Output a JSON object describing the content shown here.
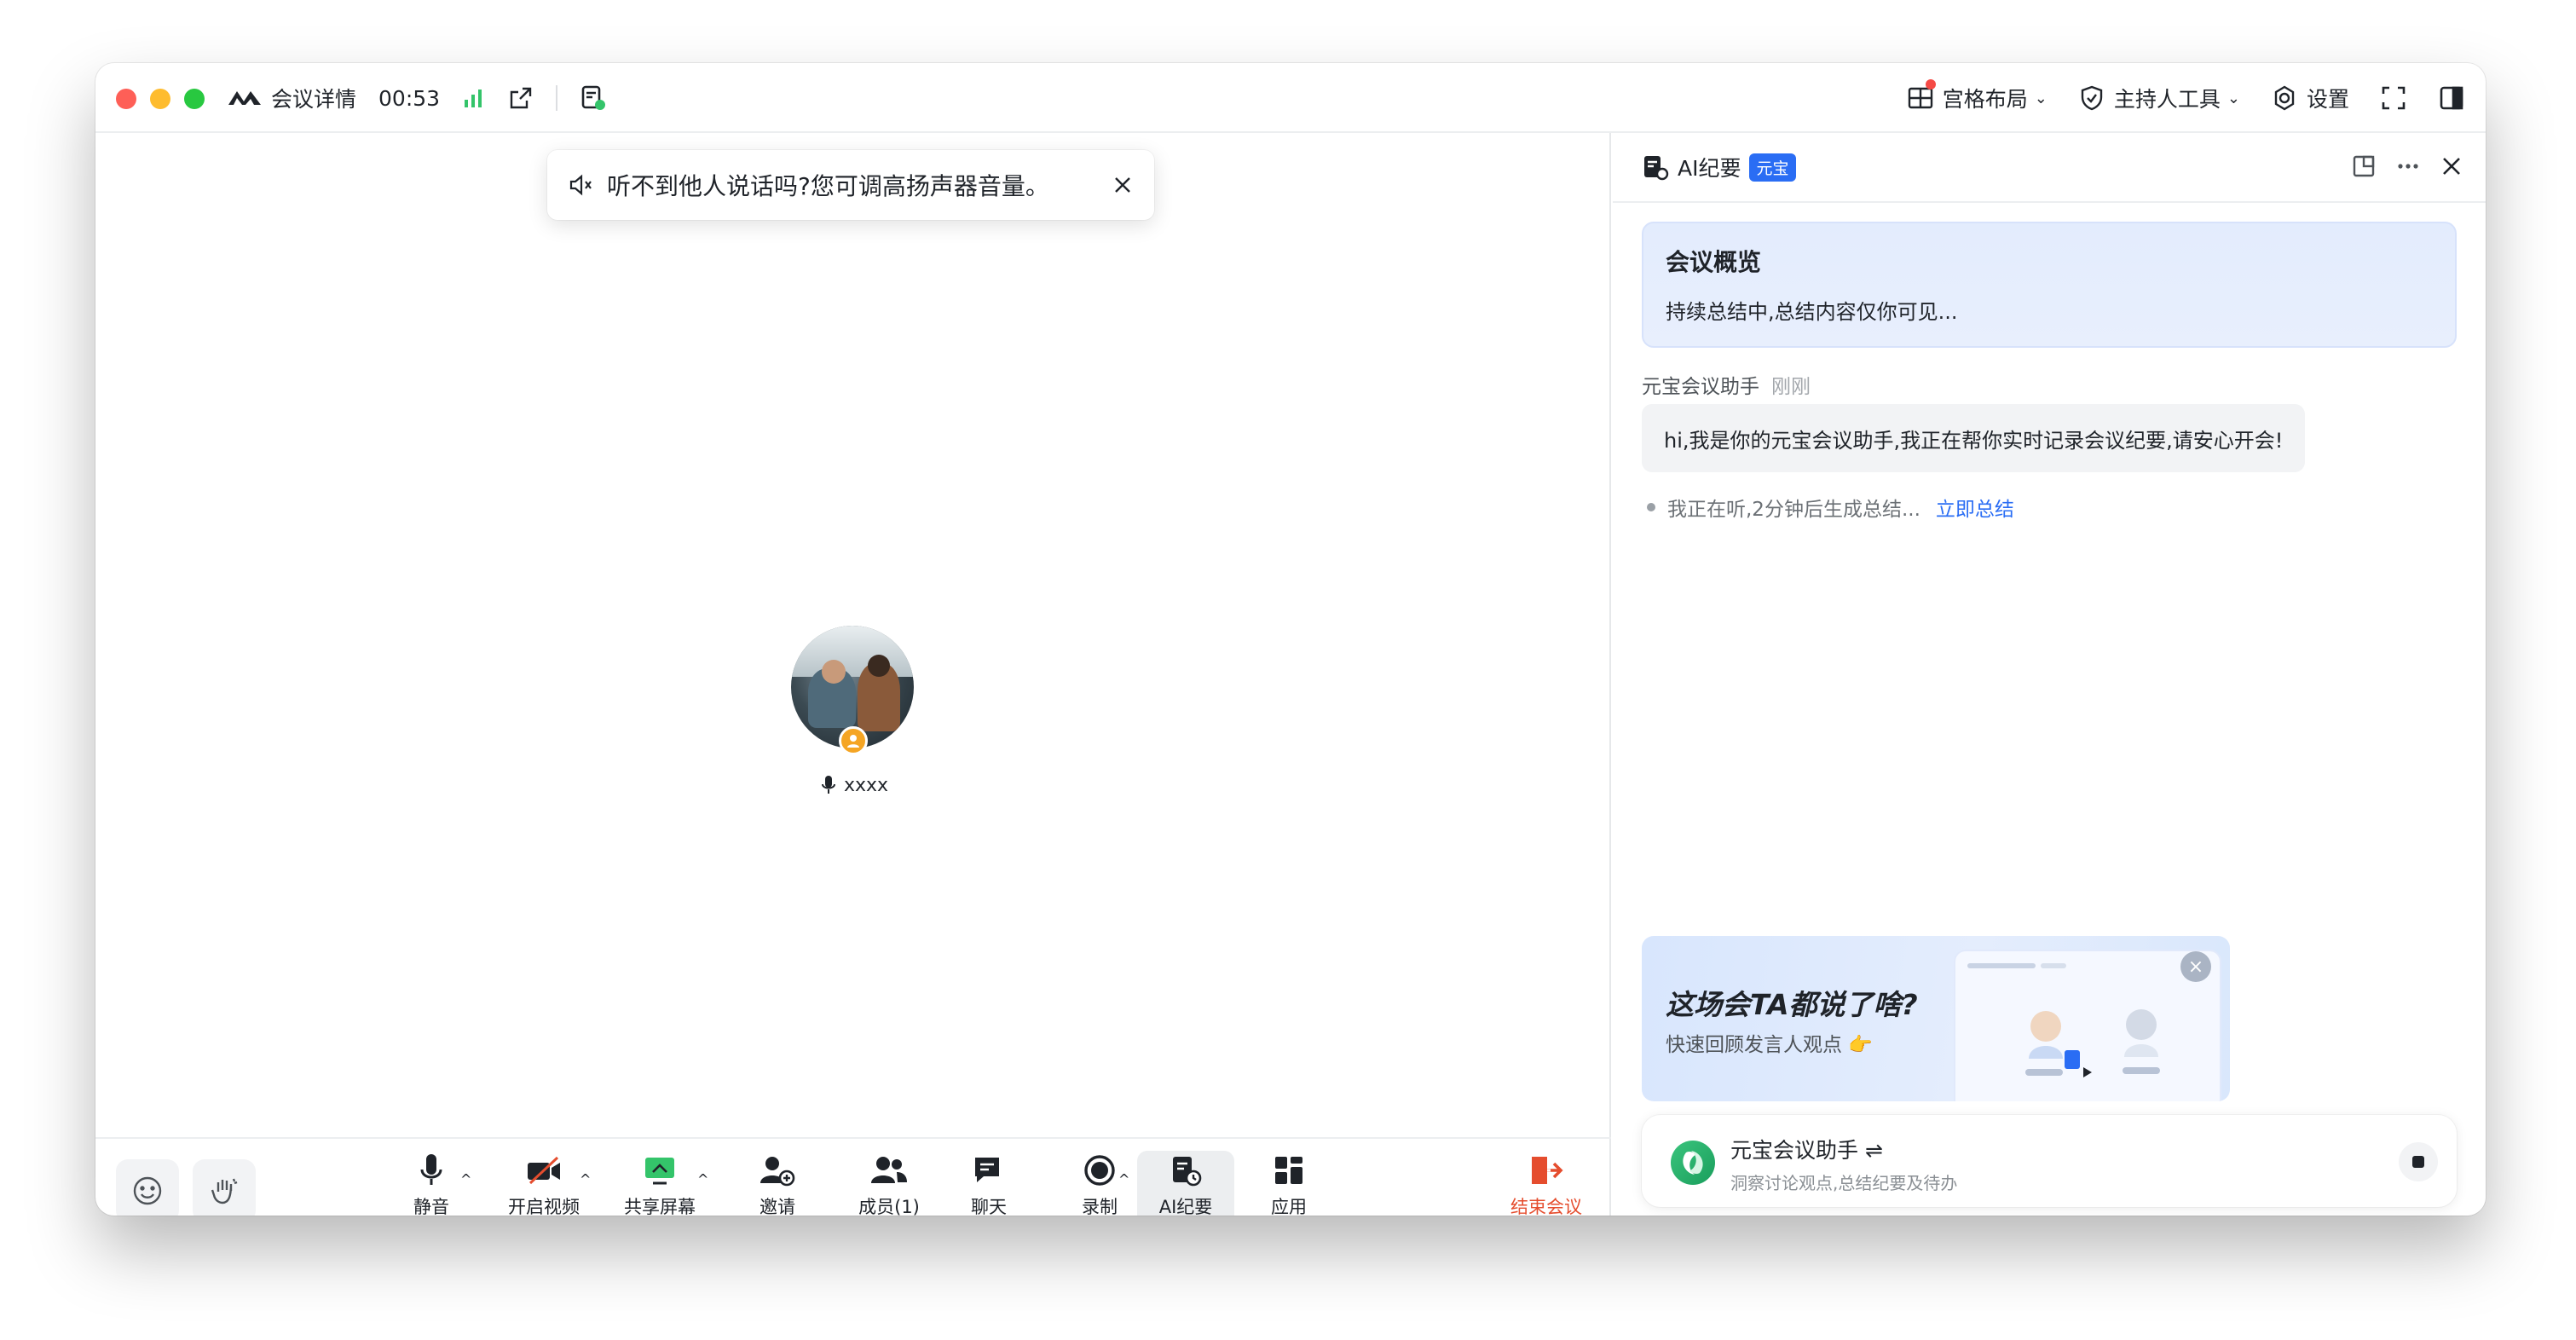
{
  "titlebar": {
    "meeting_details": "会议详情",
    "timer": "00:53",
    "layout": "宫格布局",
    "host_tools": "主持人工具",
    "settings": "设置"
  },
  "toast": {
    "message": "听不到他人说话吗?您可调高扬声器音量。"
  },
  "participant": {
    "name": "xxxx"
  },
  "toolbar": {
    "mute": "静音",
    "video": "开启视频",
    "share": "共享屏幕",
    "invite": "邀请",
    "members": "成员(1)",
    "chat": "聊天",
    "record": "录制",
    "ai_minutes": "AI纪要",
    "apps": "应用",
    "end": "结束会议"
  },
  "panel": {
    "title": "AI纪要",
    "badge": "元宝",
    "overview_title": "会议概览",
    "overview_sub": "持续总结中,总结内容仅你可见...",
    "assistant_name": "元宝会议助手",
    "assistant_time": "刚刚",
    "message": "hi,我是你的元宝会议助手,我正在帮你实时记录会议纪要,请安心开会!",
    "listening": "我正在听,2分钟后生成总结...",
    "summarize_now": "立即总结",
    "promo_title": "这场会TA都说了啥?",
    "promo_sub": "快速回顾发言人观点 👉",
    "assist_bar_name": "元宝会议助手",
    "assist_bar_swap": "⇌",
    "assist_bar_desc": "洞察讨论观点,总结纪要及待办"
  },
  "colors": {
    "accent": "#2a6df4",
    "danger": "#e54d2e",
    "signal": "#34c46a"
  }
}
